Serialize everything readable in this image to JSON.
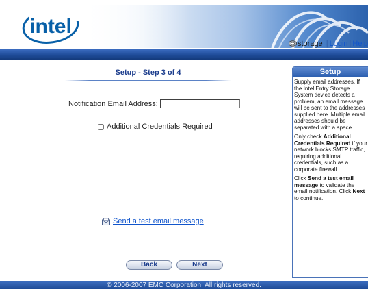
{
  "header": {
    "logo_text": "intel",
    "storage_label": "storage",
    "separator": "|",
    "login_link": "Login",
    "help_link": "Help"
  },
  "main": {
    "step_title": "Setup - Step 3 of 4",
    "email_label": "Notification Email Address:",
    "email_value": "",
    "credentials_label": "Additional Credentials Required",
    "credentials_checked": false,
    "test_email_link": "Send a test email message",
    "back_button": "Back",
    "next_button": "Next"
  },
  "sidebar": {
    "title": "Setup",
    "p1": "Supply email addresses. If the Intel Entry Storage System device detects a problem, an email message will be sent to the addresses supplied here. Multiple email addresses should be separated with a space.",
    "p2_pre": "Only check ",
    "p2_bold": "Additional Credentials Required",
    "p2_post": " if your network blocks SMTP traffic, requiring additional credentials, such as a corporate firewall.",
    "p3_pre": "Click ",
    "p3_bold1": "Send a test email message",
    "p3_mid": " to validate the email notification. Click ",
    "p3_bold2": "Next",
    "p3_post": " to continue."
  },
  "footer": {
    "copyright": "© 2006-2007 EMC Corporation. All rights reserved."
  },
  "colors": {
    "brand_blue": "#0860a8",
    "bar_blue": "#1f4c9a",
    "title_blue": "#1b3c8c",
    "link_blue": "#1155cc"
  },
  "icons": {
    "logo": "intel-logo",
    "storage": "storage-icon",
    "mail": "mail-icon",
    "checkbox": "checkbox"
  }
}
